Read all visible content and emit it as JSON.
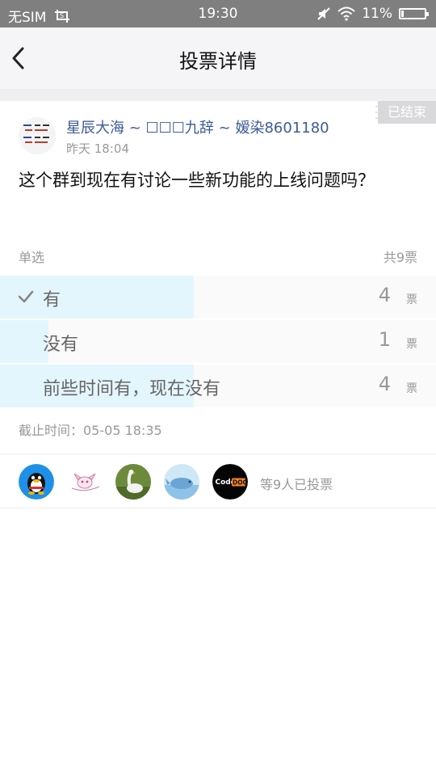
{
  "status_bar": {
    "carrier": "无SIM",
    "time": "19:30",
    "battery_percent": "11%",
    "battery_level": 0.11
  },
  "header": {
    "title": "投票详情"
  },
  "poll": {
    "ended_tag": "已结束",
    "author": "星辰大海 ~ ☐☐☐九辞 ~ 嫒染8601180",
    "time": "昨天 18:04",
    "question": "这个群到现在有讨论一些新功能的上线问题吗？",
    "mode": "单选",
    "total": "共9票",
    "vote_unit": "票",
    "options": [
      {
        "label": "有",
        "count": "4",
        "fraction": 0.444,
        "selected": true
      },
      {
        "label": "没有",
        "count": "1",
        "fraction": 0.111,
        "selected": false
      },
      {
        "label": "前些时间有，现在没有",
        "count": "4",
        "fraction": 0.444,
        "selected": false
      }
    ],
    "deadline": "截止时间：05-05 18:35",
    "voters_text": "等9人已投票",
    "voter_avatar_logo_text": "CodeDOG"
  }
}
